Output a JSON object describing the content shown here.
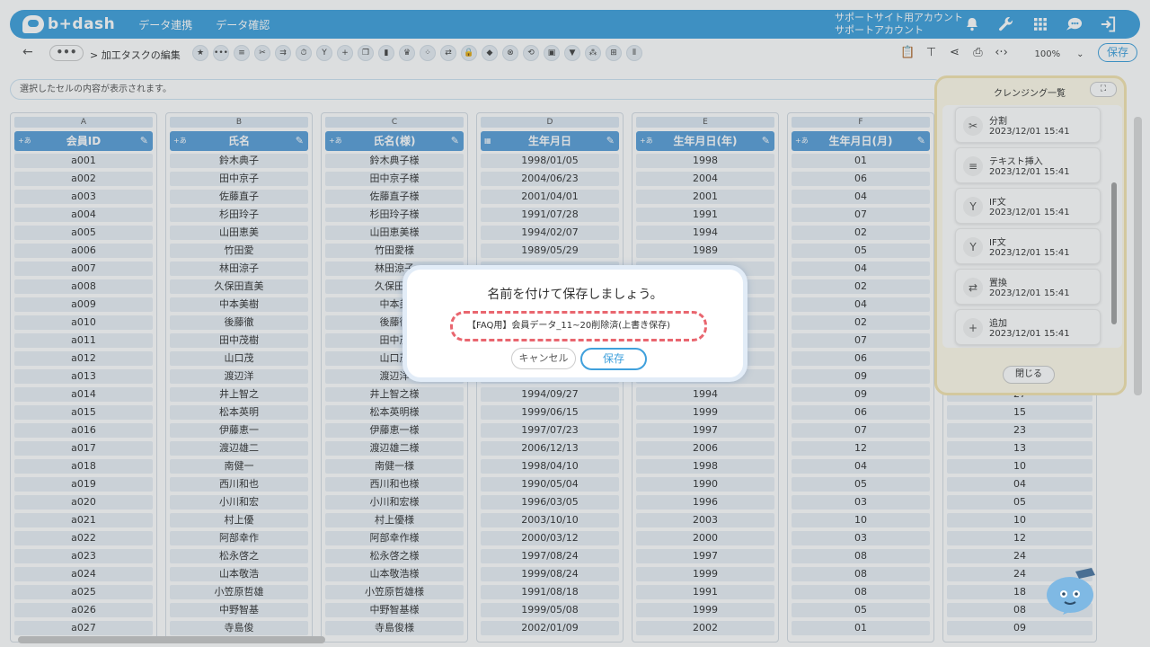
{
  "app": {
    "logo_text": "b+dash"
  },
  "nav": {
    "items": [
      "データ連携",
      "データ確認"
    ]
  },
  "account": {
    "line1": "サポートサイト用アカウント",
    "line2": "サポートアカウント"
  },
  "top_icons": [
    "bell-icon",
    "wrench-icon",
    "grid-icon",
    "chat-icon",
    "logout-icon"
  ],
  "breadcrumb": {
    "text": "> 加工タスクの編集"
  },
  "toolbar": {
    "zoom": "100%",
    "save_label": "保存"
  },
  "cellbar": {
    "placeholder": "選択したセルの内容が表示されます。"
  },
  "grid": {
    "columns": [
      {
        "letter": "A",
        "type": "+あ",
        "header": "会員ID",
        "values": [
          "a001",
          "a002",
          "a003",
          "a004",
          "a005",
          "a006",
          "a007",
          "a008",
          "a009",
          "a010",
          "a011",
          "a012",
          "a013",
          "a014",
          "a015",
          "a016",
          "a017",
          "a018",
          "a019",
          "a020",
          "a021",
          "a022",
          "a023",
          "a024",
          "a025",
          "a026",
          "a027"
        ]
      },
      {
        "letter": "B",
        "type": "+あ",
        "header": "氏名",
        "values": [
          "鈴木典子",
          "田中京子",
          "佐藤直子",
          "杉田玲子",
          "山田恵美",
          "竹田愛",
          "林田涼子",
          "久保田直美",
          "中本美樹",
          "後藤徹",
          "田中茂樹",
          "山口茂",
          "渡辺洋",
          "井上智之",
          "松本英明",
          "伊藤恵一",
          "渡辺雄二",
          "南健一",
          "西川和也",
          "小川和宏",
          "村上優",
          "阿部幸作",
          "松永啓之",
          "山本敬浩",
          "小笠原哲雄",
          "中野智基",
          "寺島俊"
        ]
      },
      {
        "letter": "C",
        "type": "+あ",
        "header": "氏名(様)",
        "values": [
          "鈴木典子様",
          "田中京子様",
          "佐藤直子様",
          "杉田玲子様",
          "山田恵美様",
          "竹田愛様",
          "林田涼子",
          "久保田直",
          "中本美",
          "後藤徹",
          "田中茂",
          "山口茂",
          "渡辺洋",
          "井上智之様",
          "松本英明様",
          "伊藤恵一様",
          "渡辺雄二様",
          "南健一様",
          "西川和也様",
          "小川和宏様",
          "村上優様",
          "阿部幸作様",
          "松永啓之様",
          "山本敬浩様",
          "小笠原哲雄様",
          "中野智基様",
          "寺島俊様"
        ]
      },
      {
        "letter": "D",
        "type": "cal",
        "header": "生年月日",
        "values": [
          "1998/01/05",
          "2004/06/23",
          "2001/04/01",
          "1991/07/28",
          "1994/02/07",
          "1989/05/29",
          "",
          "",
          "",
          "",
          "",
          "",
          "",
          "1994/09/27",
          "1999/06/15",
          "1997/07/23",
          "2006/12/13",
          "1998/04/10",
          "1990/05/04",
          "1996/03/05",
          "2003/10/10",
          "2000/03/12",
          "1997/08/24",
          "1999/08/24",
          "1991/08/18",
          "1999/05/08",
          "2002/01/09"
        ]
      },
      {
        "letter": "E",
        "type": "+あ",
        "header": "生年月日(年)",
        "values": [
          "1998",
          "2004",
          "2001",
          "1991",
          "1994",
          "1989",
          "",
          "",
          "",
          "",
          "",
          "",
          "",
          "1994",
          "1999",
          "1997",
          "2006",
          "1998",
          "1990",
          "1996",
          "2003",
          "2000",
          "1997",
          "1999",
          "1991",
          "1999",
          "2002"
        ]
      },
      {
        "letter": "F",
        "type": "+あ",
        "header": "生年月日(月)",
        "values": [
          "01",
          "06",
          "04",
          "07",
          "02",
          "05",
          "04",
          "02",
          "04",
          "02",
          "07",
          "06",
          "09",
          "09",
          "06",
          "07",
          "12",
          "04",
          "05",
          "03",
          "10",
          "03",
          "08",
          "08",
          "08",
          "05",
          "01"
        ]
      },
      {
        "letter": "",
        "type": "",
        "header": "",
        "values": [
          "",
          "",
          "",
          "",
          "",
          "",
          "",
          "",
          "",
          "",
          "",
          "",
          "",
          "27",
          "15",
          "23",
          "13",
          "10",
          "04",
          "05",
          "10",
          "12",
          "24",
          "24",
          "18",
          "08",
          "09"
        ]
      }
    ]
  },
  "panel": {
    "title": "クレンジング一覧",
    "expand_icon": "expand-icon",
    "close_label": "閉じる",
    "items": [
      {
        "icon": "✂",
        "icon_name": "split-icon",
        "name": "分割",
        "time": "2023/12/01 15:41"
      },
      {
        "icon": "≡",
        "icon_name": "text-insert-icon",
        "name": "テキスト挿入",
        "time": "2023/12/01 15:41"
      },
      {
        "icon": "Y",
        "icon_name": "if-branch-icon",
        "name": "IF文",
        "time": "2023/12/01 15:41"
      },
      {
        "icon": "Y",
        "icon_name": "if-branch-icon",
        "name": "IF文",
        "time": "2023/12/01 15:41"
      },
      {
        "icon": "⇄",
        "icon_name": "replace-icon",
        "name": "置換",
        "time": "2023/12/01 15:41"
      },
      {
        "icon": "+",
        "icon_name": "add-icon",
        "name": "追加",
        "time": "2023/12/01 15:41"
      }
    ]
  },
  "dialog": {
    "title": "名前を付けて保存しましょう。",
    "input_value": "【FAQ用】会員データ_11~20削除済(上書き保存)",
    "cancel_label": "キャンセル",
    "save_label": "保存"
  }
}
